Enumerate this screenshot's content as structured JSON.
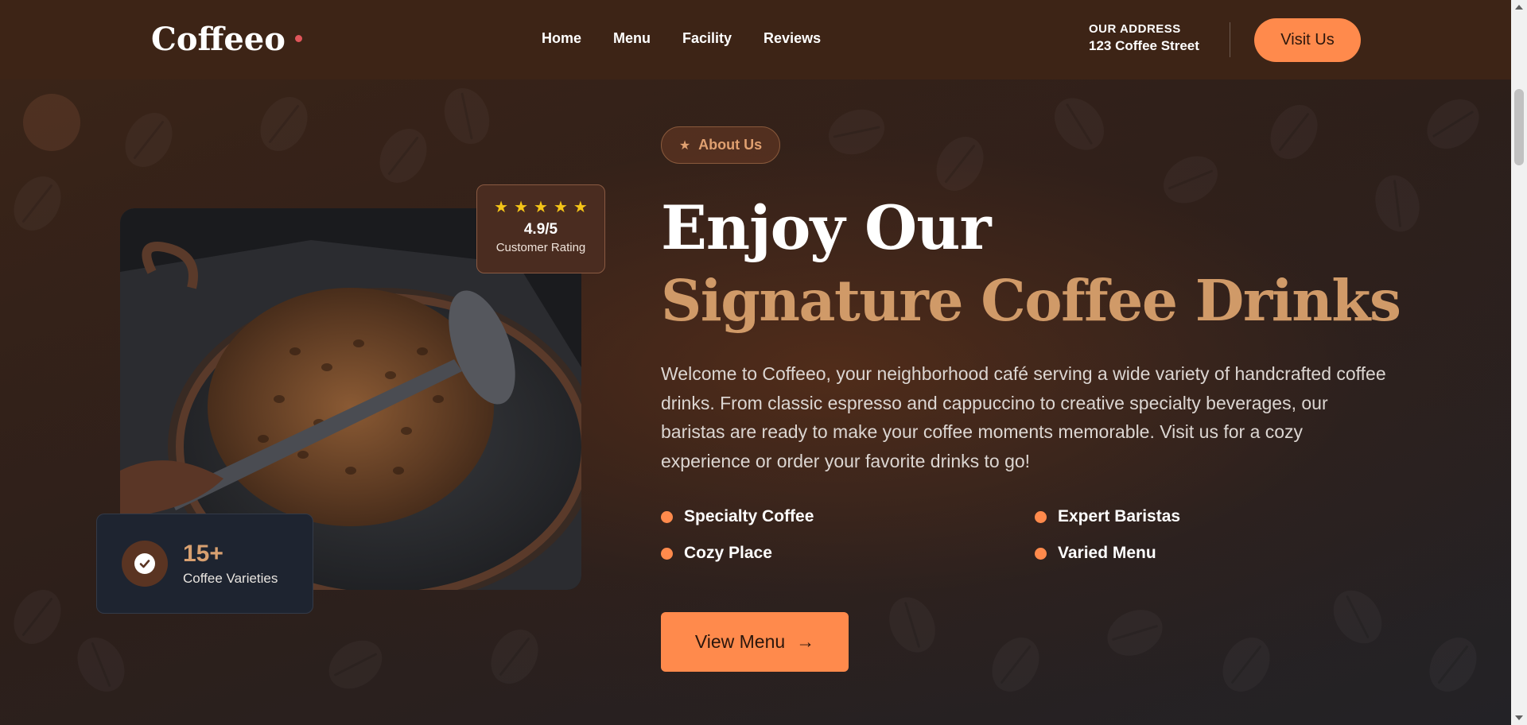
{
  "header": {
    "logo": "Coffeeo",
    "nav": [
      "Home",
      "Menu",
      "Facility",
      "Reviews"
    ],
    "address_label": "OUR ADDRESS",
    "address_value": "123 Coffee Street",
    "visit_button": "Visit Us"
  },
  "hero": {
    "about_pill": "About Us",
    "title_line1": "Enjoy Our",
    "title_line2": "Signature Coffee Drinks",
    "description": "Welcome to Coffeeo, your neighborhood café serving a wide variety of handcrafted coffee drinks. From classic espresso and cappuccino to creative specialty beverages, our baristas are ready to make your coffee moments memorable. Visit us for a cozy experience or order your favorite drinks to go!",
    "features": [
      "Specialty Coffee",
      "Expert Baristas",
      "Cozy Place",
      "Varied Menu"
    ],
    "cta": "View Menu",
    "cta_arrow": "→"
  },
  "rating_card": {
    "stars": 5,
    "value": "4.9/5",
    "label": "Customer Rating"
  },
  "variety_card": {
    "count": "15+",
    "label": "Coffee Varieties"
  },
  "colors": {
    "accent": "#ff8a4c",
    "title_gold": "#d09a68",
    "header_bg": "#3d2416"
  },
  "icons": {
    "logo_dot": "dot-icon",
    "pill": "star-icon",
    "variety": "check-circle-icon",
    "cta": "arrow-right-icon"
  }
}
